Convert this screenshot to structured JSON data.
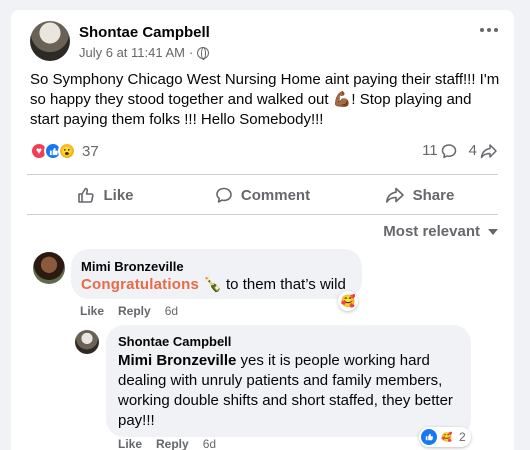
{
  "post": {
    "author": "Shontae Campbell",
    "timestamp": "July 6 at 11:41 AM",
    "separator": "·",
    "text": "So Symphony Chicago West Nursing Home  aint paying their staff!!! I'm so happy they stood together and walked out 💪🏾! Stop playing and start paying them folks !!! Hello Somebody!!!",
    "reaction_count": "37",
    "comment_count": "11",
    "share_count": "4",
    "reaction_icons": [
      "love-icon",
      "like-icon",
      "wow-icon"
    ]
  },
  "actions": {
    "like": "Like",
    "comment": "Comment",
    "share": "Share"
  },
  "sort": {
    "label": "Most relevant"
  },
  "comments": [
    {
      "author": "Mimi Bronzeville",
      "text_highlight": "Congratulations",
      "text_rest": "🍾 to them that’s wild",
      "reaction_icon": "care-icon",
      "like": "Like",
      "reply": "Reply",
      "time": "6d"
    },
    {
      "author": "Shontae Campbell",
      "mention": "Mimi Bronzeville",
      "text": " yes it is people working hard dealing with unruly patients and family members, working double shifts and short staffed, they better pay!!!",
      "reaction_count": "2",
      "reaction_icons": [
        "like-icon",
        "care-icon"
      ],
      "like": "Like",
      "reply": "Reply",
      "time": "6d"
    }
  ],
  "colors": {
    "accent": "#1877f2",
    "love": "#f33e58",
    "wow": "#f7b928",
    "highlight": "#e86a47",
    "muted": "#65676b"
  }
}
